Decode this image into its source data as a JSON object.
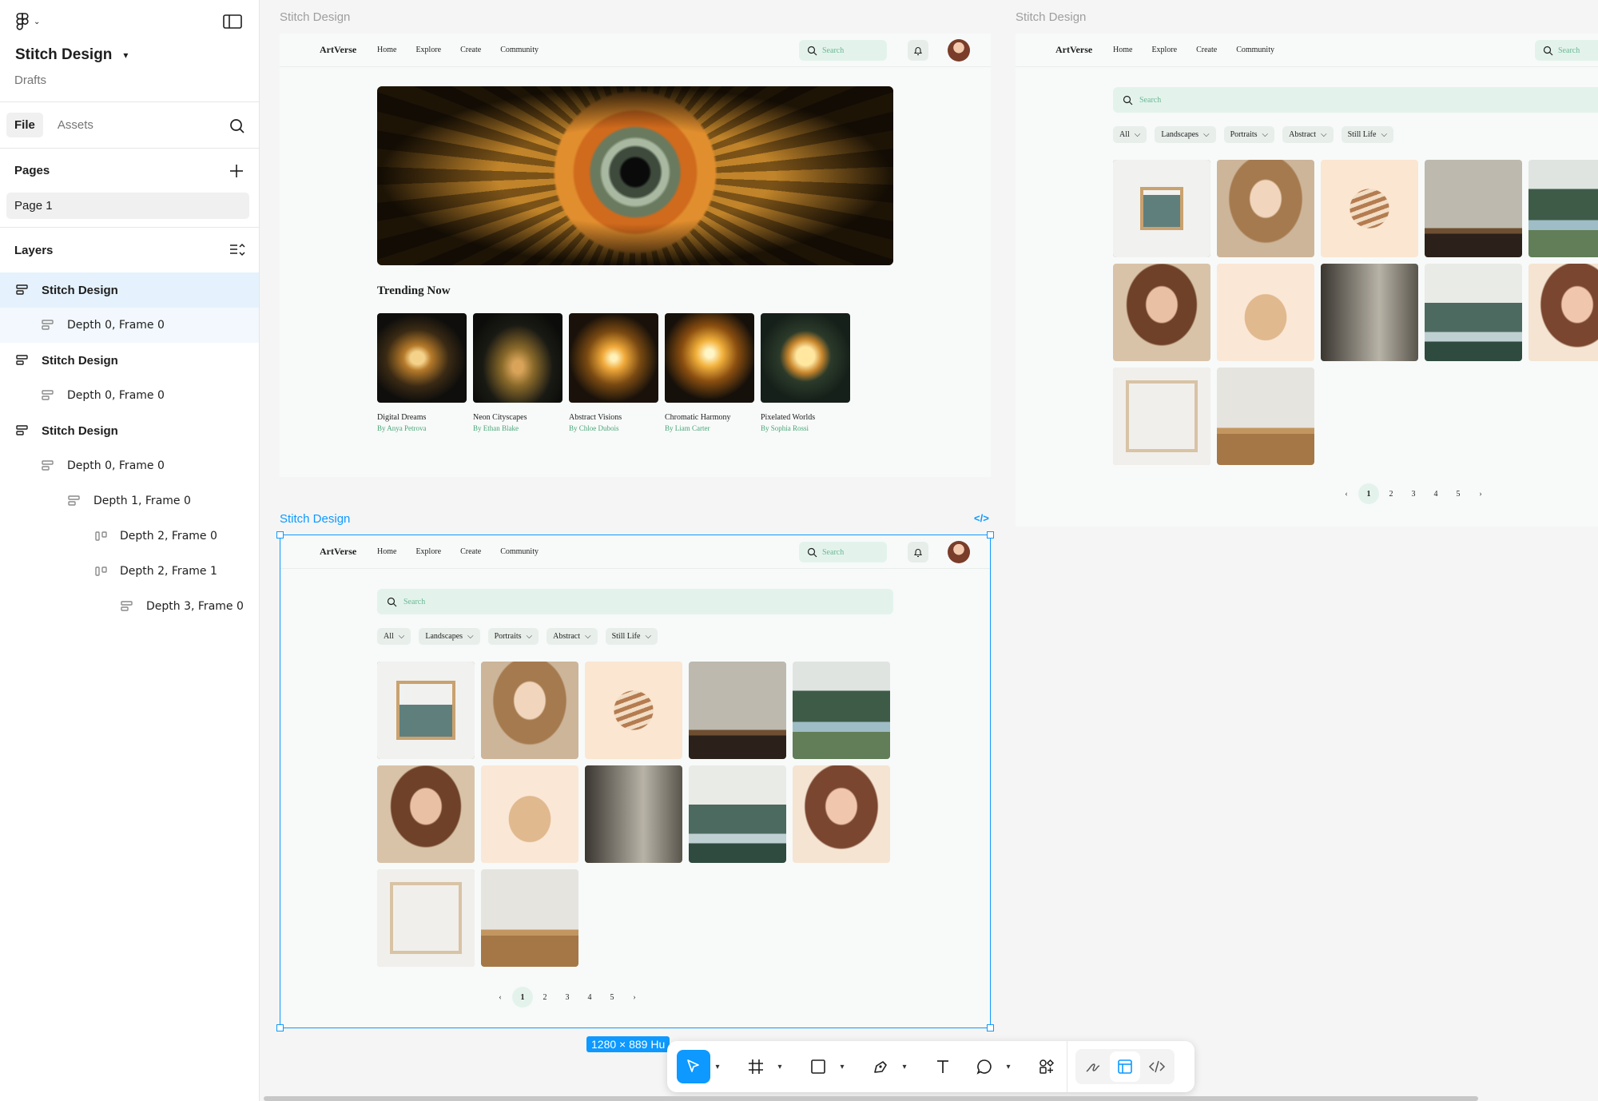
{
  "sidebar": {
    "file_name": "Stitch Design",
    "file_location": "Drafts",
    "tabs": [
      "File",
      "Assets"
    ],
    "pages_header": "Pages",
    "pages": [
      "Page 1"
    ],
    "layers_header": "Layers",
    "layers": [
      {
        "label": "Stitch Design"
      },
      {
        "label": "Depth 0, Frame 0"
      },
      {
        "label": "Stitch Design"
      },
      {
        "label": "Depth 0, Frame 0"
      },
      {
        "label": "Stitch Design"
      },
      {
        "label": "Depth 0, Frame 0"
      },
      {
        "label": "Depth 1, Frame 0"
      },
      {
        "label": "Depth 2, Frame 0"
      },
      {
        "label": "Depth 2, Frame 1"
      },
      {
        "label": "Depth 3, Frame 0"
      }
    ]
  },
  "frames": {
    "label_1": "Stitch Design",
    "label_2": "Stitch Design",
    "label_3": "Stitch Design",
    "size_badge": "1280 × 889 Hu",
    "code_icon": "</>"
  },
  "site": {
    "brand": "ArtVerse",
    "nav": [
      "Home",
      "Explore",
      "Create",
      "Community"
    ],
    "search_placeholder": "Search",
    "trending_title": "Trending Now",
    "cards": [
      {
        "title": "Digital Dreams",
        "author": "By Anya Petrova"
      },
      {
        "title": "Neon Cityscapes",
        "author": "By Ethan Blake"
      },
      {
        "title": "Abstract Visions",
        "author": "By Chloe Dubois"
      },
      {
        "title": "Chromatic Harmony",
        "author": "By Liam Carter"
      },
      {
        "title": "Pixelated Worlds",
        "author": "By Sophia Rossi"
      }
    ],
    "filters": [
      "All",
      "Landscapes",
      "Portraits",
      "Abstract",
      "Still Life"
    ],
    "pages": [
      "1",
      "2",
      "3",
      "4",
      "5"
    ]
  },
  "colors": {
    "accent": "#0d99ff",
    "mint": "#e3f3ec",
    "author_green": "#4aa578"
  }
}
